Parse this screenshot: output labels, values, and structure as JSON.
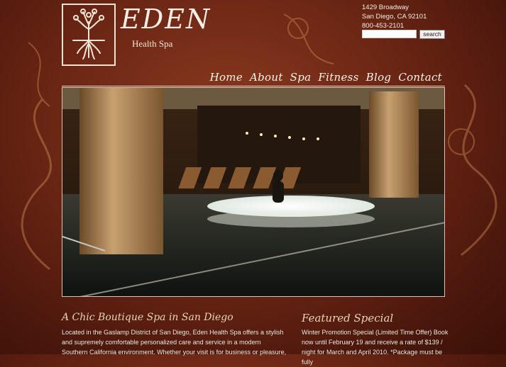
{
  "brand": {
    "name": "EDEN",
    "subtitle": "Health Spa"
  },
  "contact": {
    "street": "1429 Broadway",
    "city": "San Diego, CA 92101",
    "phone": "800-453-2101"
  },
  "search": {
    "placeholder": "",
    "button_label": "search"
  },
  "nav": {
    "items": [
      "Home",
      "About",
      "Spa",
      "Fitness",
      "Blog",
      "Contact"
    ]
  },
  "intro": {
    "title": "A Chic Boutique Spa in San Diego",
    "lines": [
      "Located in the Gaslamp District of San Diego, Eden Health Spa offers a stylish",
      "and supremely comfortable personalized care and service in a modern",
      "Southern California environment. Whether your visit is for business or pleasure,"
    ]
  },
  "featured": {
    "title": "Featured Special",
    "lines": [
      "Winter Promotion Special (Limited Time Offer) Book",
      "now until February 19 and receive a rate of $139 /",
      "night for March and April 2010. *Package must be fully"
    ]
  },
  "colors": {
    "background": "#6b2614",
    "accent_text": "#e8d4b4",
    "nav_text": "#fbf5ec"
  }
}
